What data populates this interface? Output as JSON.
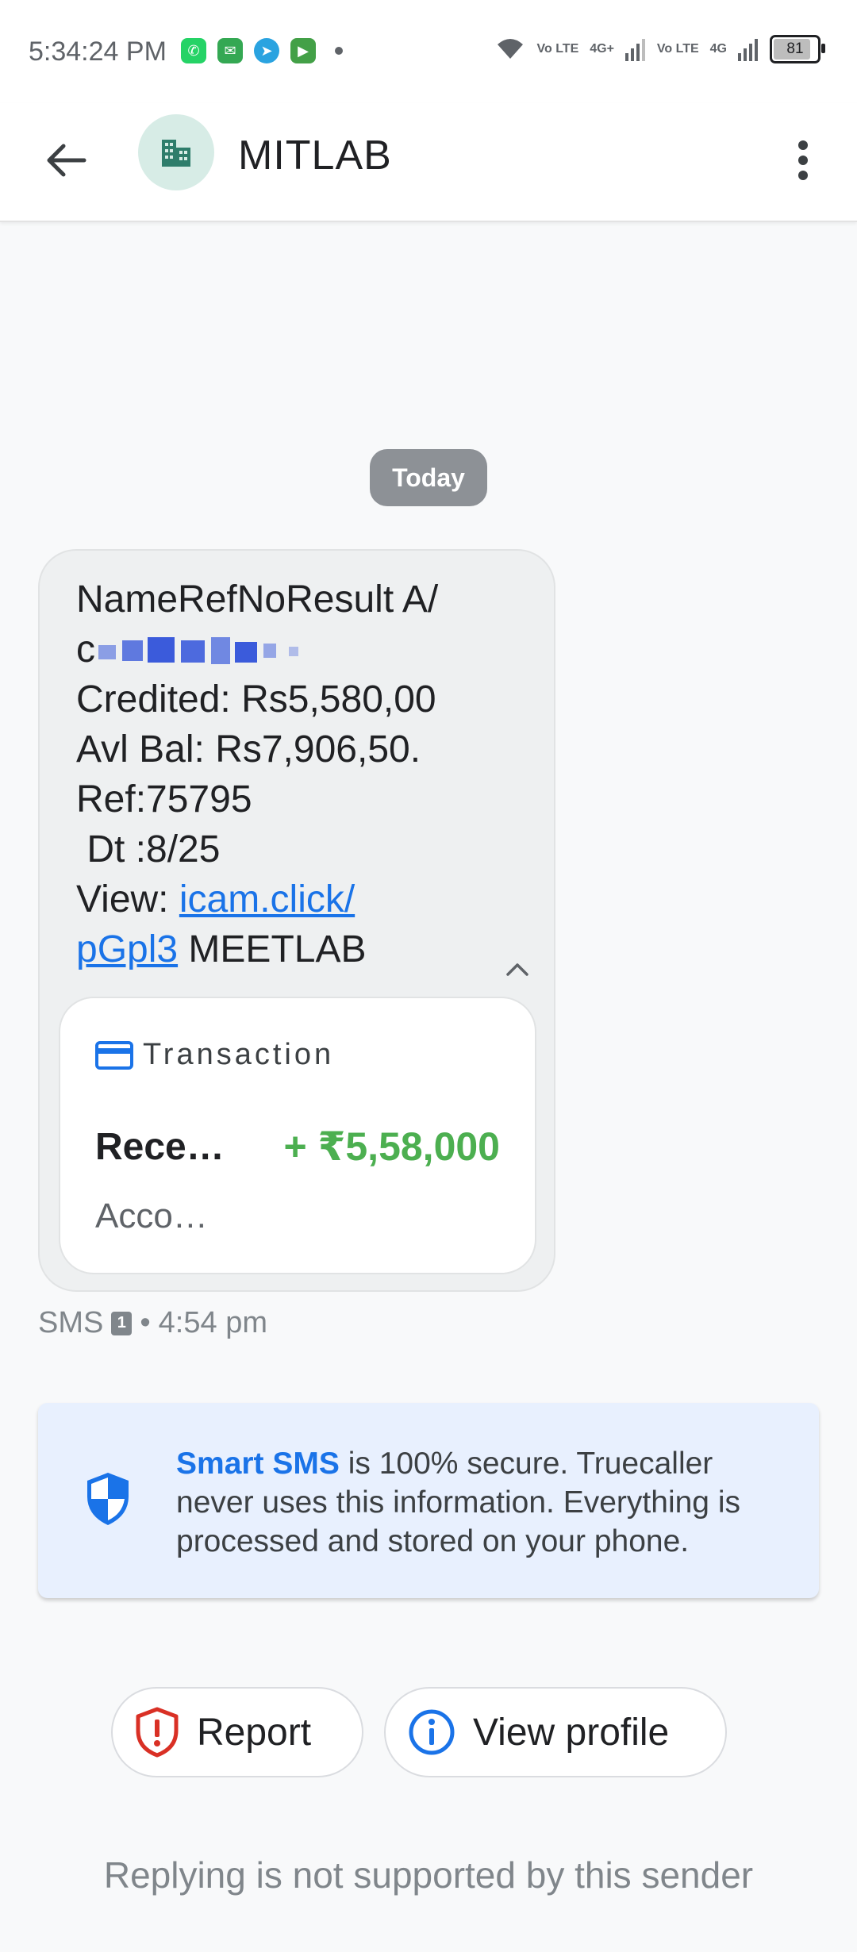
{
  "status_bar": {
    "time": "5:34:24 PM",
    "network_1": "Vo LTE",
    "network_2": "4G+",
    "network_3": "Vo LTE",
    "network_4": "4G",
    "battery": "81"
  },
  "header": {
    "sender_name": "MITLAB"
  },
  "date_chip": "Today",
  "message": {
    "line1": "NameRefNoResult A/",
    "line2_prefix": "c",
    "line3": "Credited: Rs5,580,00",
    "line4": "Avl Bal: Rs7,906,50.",
    "line5": "Ref:75795",
    "line6": " Dt :8/25",
    "line7_prefix": "View: ",
    "link_part1": "icam.click/",
    "link_part2": "pGpl3",
    "line8_suffix": " MEETLAB"
  },
  "transaction_card": {
    "title": "Transaction",
    "label": "Rece…",
    "amount": "+ ₹5,58,000",
    "sub_label": "Acco…",
    "amount_color": "#4caf50"
  },
  "message_meta": {
    "type": "SMS",
    "sim": "1",
    "separator": "•",
    "time": "4:54 pm"
  },
  "info_card": {
    "highlight": "Smart SMS",
    "text": " is 100% secure. Truecaller never uses this information. Everything is processed and stored on your phone."
  },
  "actions": {
    "report_label": "Report",
    "view_profile_label": "View profile"
  },
  "footer_notice": "Replying is not supported by this sender",
  "colors": {
    "accent": "#1a73e8",
    "report_red": "#d93025",
    "avatar_bg": "#d7ece6",
    "avatar_icon": "#2e7d6b"
  }
}
